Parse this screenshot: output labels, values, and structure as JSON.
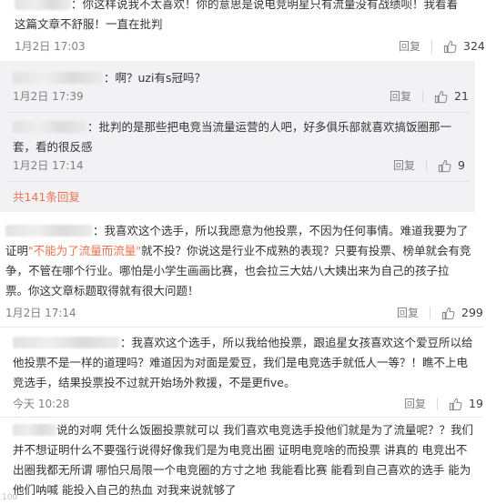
{
  "actions": {
    "reply_label": "回复"
  },
  "comments": [
    {
      "text": "：你这样说我不太喜欢！你的意思是说电竞明星只有流量没有战绩呗！我看着这篇文章不舒服！一直在批判",
      "time": "1月2日 17:03",
      "likes": "324"
    }
  ],
  "sub_replies": [
    {
      "text": "：啊？uzi有s冠吗？",
      "time": "1月2日 17:39",
      "likes": "21"
    },
    {
      "text": "：批判的是那些把电竞当流量运营的人吧，好多俱乐部就喜欢搞饭圈那一套，看的很反感",
      "time": "1月2日 17:14",
      "likes": "9"
    }
  ],
  "more_replies": "共141条回复",
  "comment2": {
    "text_a": "：我喜欢这个选手，所以我愿意为他投票，不因为任何事情。难道我要为了证明",
    "text_link": "\"不能为了流量而流量\"",
    "text_b": "就不投？你说这是行业不成熟的表现？只要有投票、榜单就会有竞争，不管在哪个行业。哪怕是小学生画画比赛，也会拉三大姑八大姨出来为自己的孩子拉票。你这文章标题取得就有很大问题！",
    "time": "1月2日 17:14",
    "likes": "299"
  },
  "comment3": {
    "text": "：我喜欢这个选手，所以我给他投票，跟追星女孩喜欢这个爱豆所以给他投票不是一样的道理吗？难道因为对面是爱豆，我们是电竞选手就低人一等？！瞧不上电竞选手，结果投票投不过就开始场外救援，不是更five。",
    "time": "今天 10:28",
    "likes": "19"
  },
  "comment4": {
    "text": "说的对啊 凭什么饭圈投票就可以 我们喜欢电竞选手投他们就是为了流量呢？？我们并不想证明什么不要强行说得好像我们是为电竞出圈 证明电竞啥的而投票 讲真的 电竞出不出圈我都无所谓 哪怕只局限一个电竞圈的方寸之地 我能看比赛 能看到自己喜欢的选手 能为他们呐喊 能投入自己的热血 对我来说就够了"
  },
  "watermark": "100"
}
